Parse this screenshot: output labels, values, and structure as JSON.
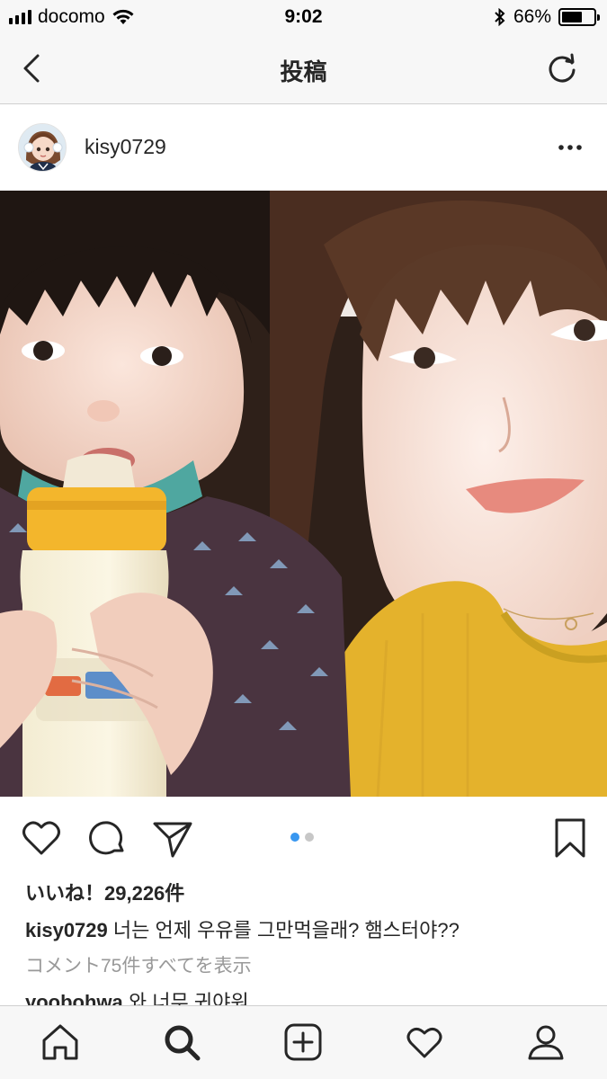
{
  "status_bar": {
    "carrier": "docomo",
    "time": "9:02",
    "battery_text": "66%",
    "battery_level": 0.66
  },
  "nav": {
    "title": "投稿",
    "back_icon": "chevron-left-icon",
    "refresh_icon": "refresh-icon"
  },
  "post": {
    "username": "kisy0729",
    "photo_alt": "selfie photo",
    "likes": "いいね！29,226件",
    "caption_user": "kisy0729",
    "caption_text": " 너는 언제 우유를 그만먹을래? 햄스터야??",
    "view_comments": "コメント75件すべてを表示",
    "comment_user": "yoobohwa",
    "comment_text": " 와 너무 귀야워",
    "carousel_count": 2,
    "carousel_active": 0
  },
  "tabs": [
    "home-icon",
    "search-icon",
    "add-icon",
    "heart-icon",
    "profile-icon"
  ],
  "colors": {
    "accent": "#3897f0",
    "bar_bg": "#f7f7f7",
    "text": "#262626",
    "muted": "#999999"
  }
}
